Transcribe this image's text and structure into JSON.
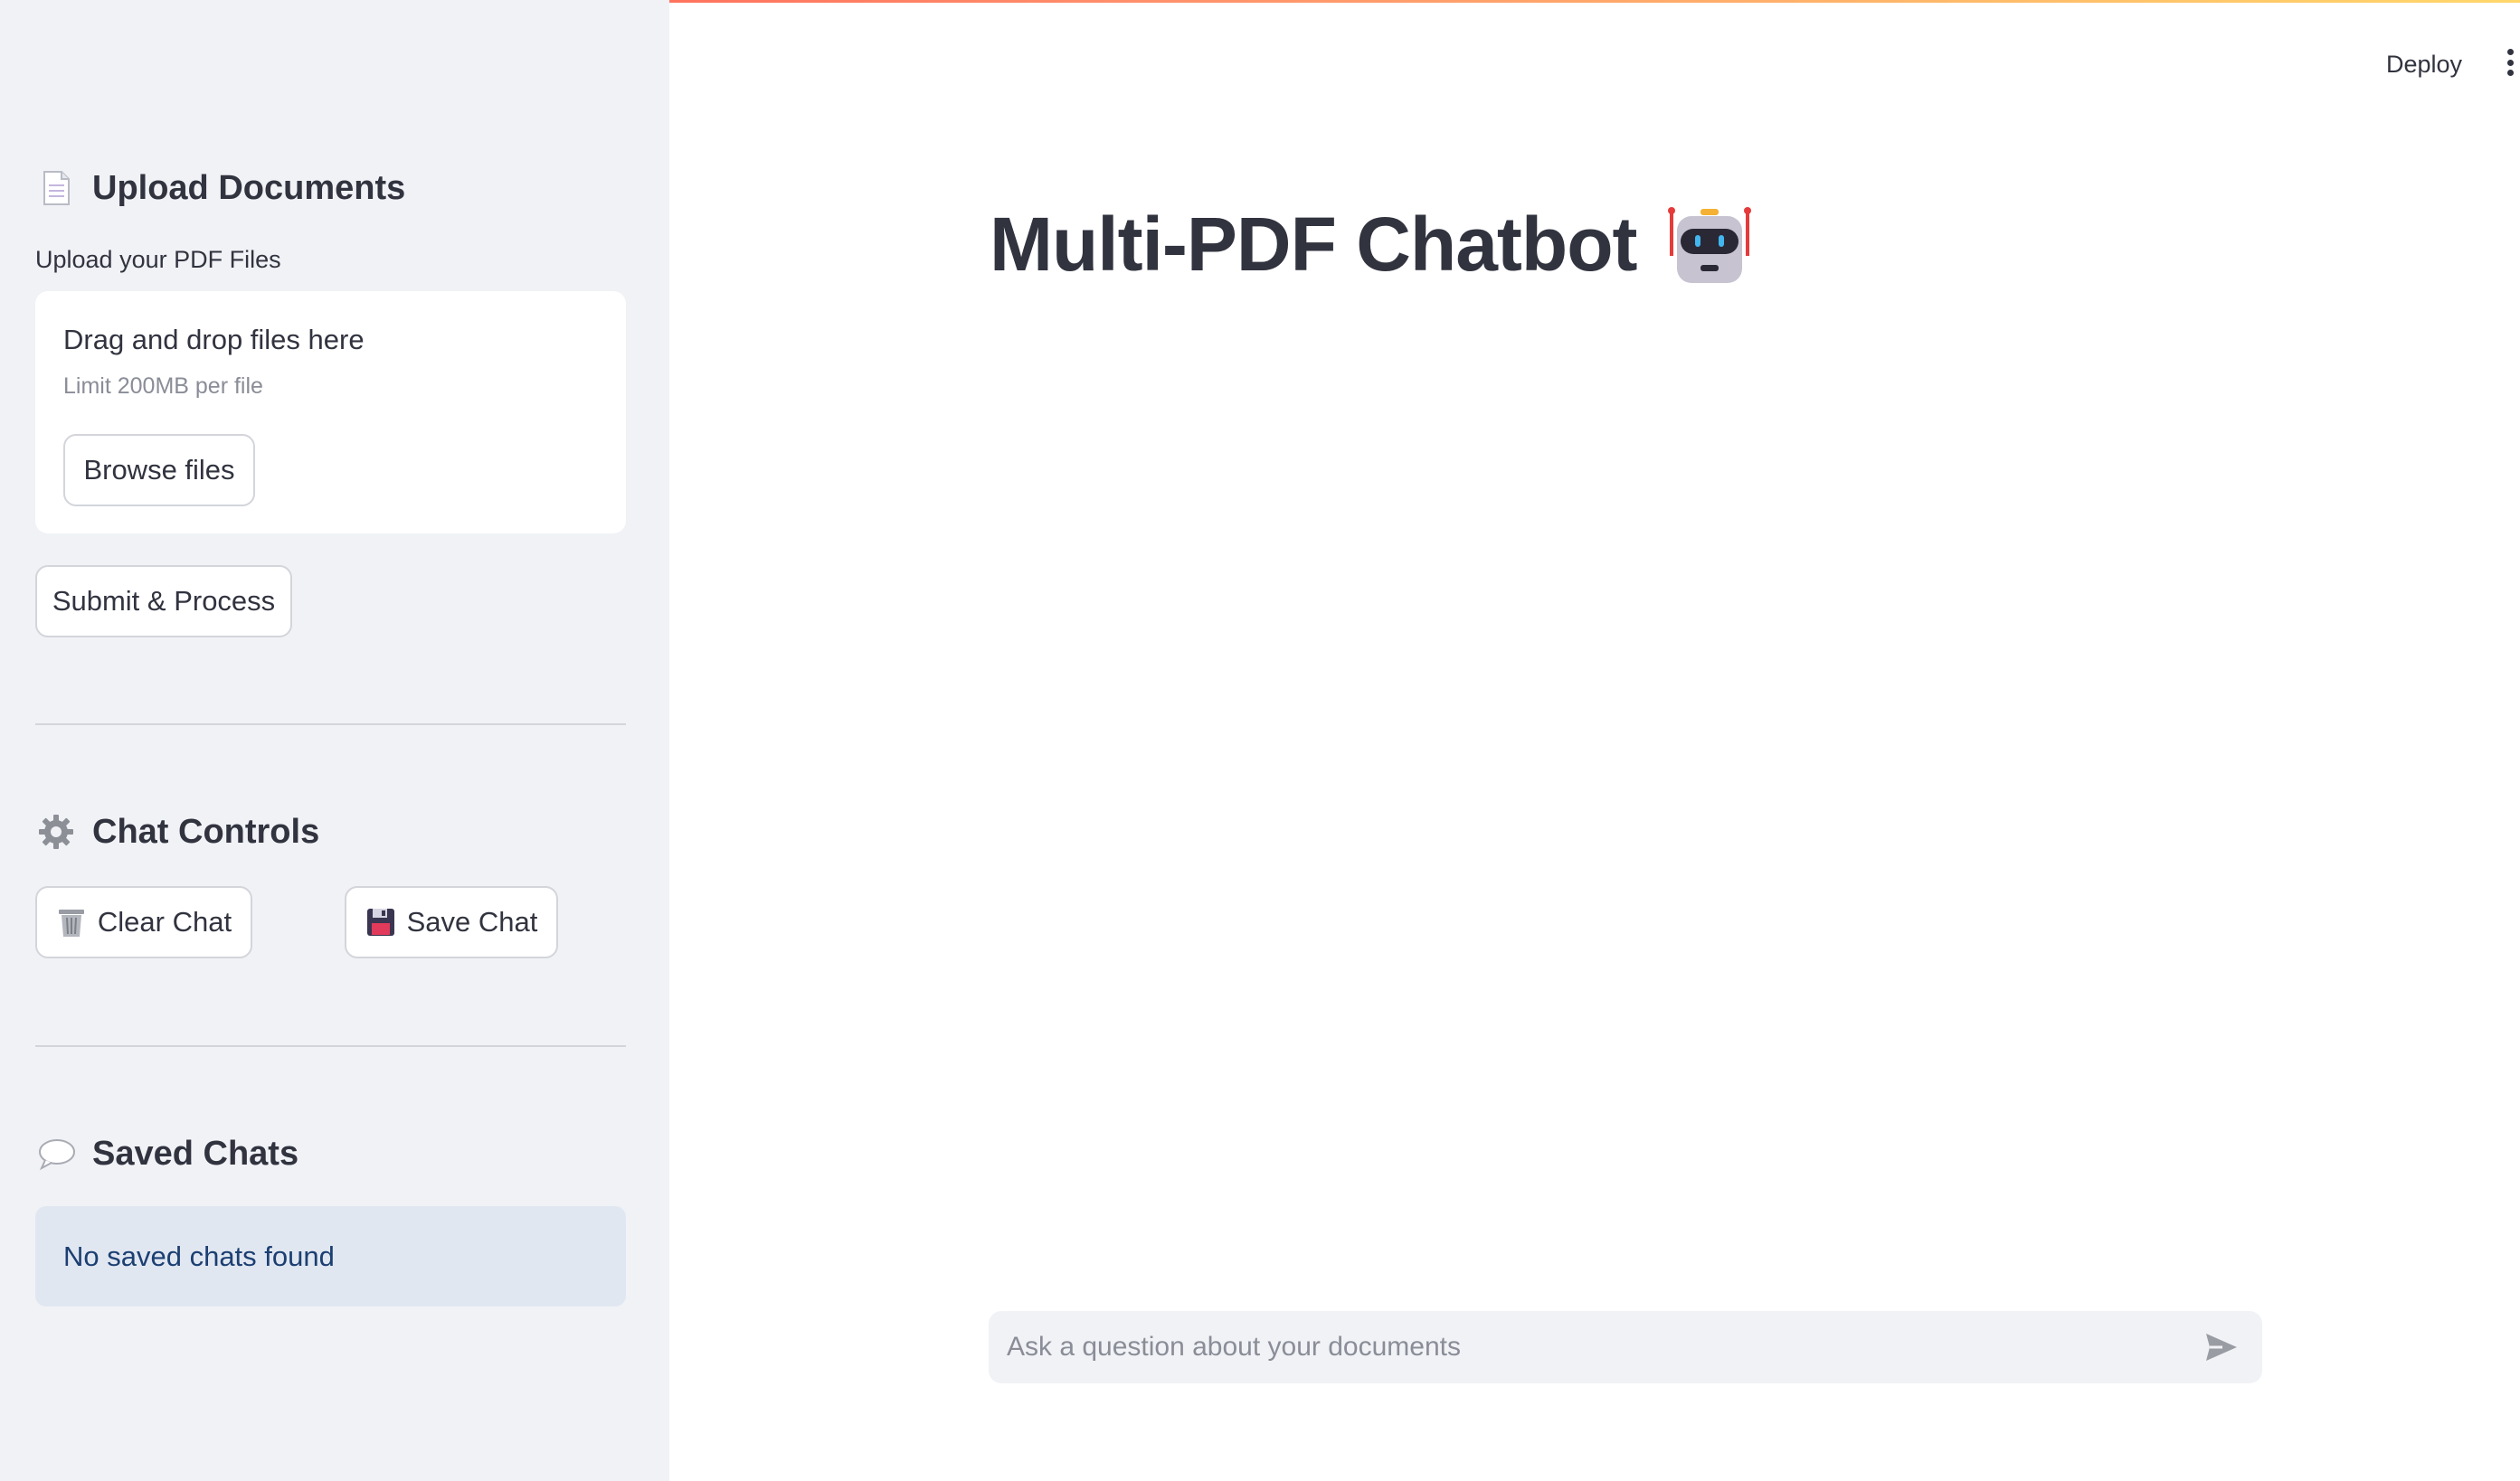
{
  "sidebar": {
    "upload_section": {
      "icon": "document-icon",
      "title": "Upload Documents",
      "field_label": "Upload your PDF Files",
      "dropzone_title": "Drag and drop files here",
      "dropzone_limit": "Limit 200MB per file",
      "browse_label": "Browse files",
      "submit_label": "Submit & Process"
    },
    "chat_controls": {
      "icon": "gear-icon",
      "title": "Chat Controls",
      "clear_icon": "trash-icon",
      "clear_label": "Clear Chat",
      "save_icon": "floppy-disk-icon",
      "save_label": "Save Chat"
    },
    "saved_chats": {
      "icon": "speech-bubble-icon",
      "title": "Saved Chats",
      "empty_message": "No saved chats found"
    }
  },
  "header": {
    "deploy_label": "Deploy",
    "menu_icon": "kebab-menu-icon"
  },
  "main": {
    "title": "Multi-PDF Chatbot",
    "title_icon": "robot-icon",
    "chat_input_placeholder": "Ask a question about your documents",
    "send_icon": "send-icon"
  },
  "colors": {
    "sidebar_bg": "#f0f2f6",
    "text": "#31333f",
    "info_bg": "#e1e7f1",
    "info_text": "#1c3f72",
    "accent_gradient": [
      "#ff4b4b",
      "#ffd76a"
    ]
  }
}
